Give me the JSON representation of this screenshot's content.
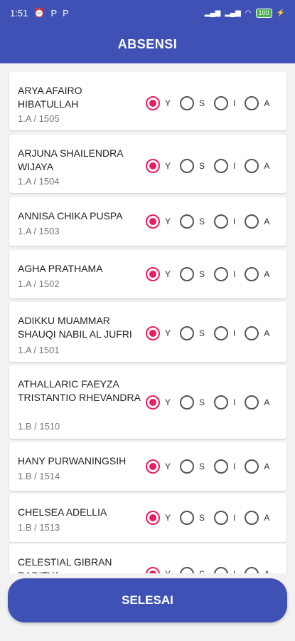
{
  "status": {
    "time": "1:51",
    "left_icons": [
      "alarm-icon",
      "parking-icon",
      "parking-icon"
    ],
    "right_icons": [
      "signal-icon",
      "signal-icon",
      "wifi-icon",
      "battery-icon",
      "charging-icon"
    ],
    "battery": "100"
  },
  "app": {
    "title": "ABSENSI"
  },
  "options": [
    "Y",
    "S",
    "I",
    "A"
  ],
  "students": [
    {
      "name": "ARYA AFAIRO HIBATULLAH",
      "info": "1.A / 1505",
      "selected": "Y"
    },
    {
      "name": "ARJUNA SHAILENDRA WIJAYA",
      "info": "1.A / 1504",
      "selected": "Y"
    },
    {
      "name": "ANNISA CHIKA PUSPA",
      "info": "1.A / 1503",
      "selected": "Y"
    },
    {
      "name": "AGHA PRATHAMA",
      "info": "1.A / 1502",
      "selected": "Y"
    },
    {
      "name": "ADIKKU MUAMMAR SHAUQI NABIL AL JUFRI",
      "info": "1.A / 1501",
      "selected": "Y"
    },
    {
      "name": "ATHALLARIC FAEYZA TRISTANTIO RHEVANDRA",
      "info": "1.B / 1510",
      "selected": "Y"
    },
    {
      "name": "HANY PURWANINGSIH",
      "info": "1.B / 1514",
      "selected": "Y"
    },
    {
      "name": "CHELSEA ADELLIA",
      "info": "1.B / 1513",
      "selected": "Y"
    },
    {
      "name": "CELESTIAL GIBRAN RADITYA",
      "info": "",
      "selected": "Y"
    }
  ],
  "footer": {
    "finish_label": "SELESAI"
  },
  "colors": {
    "primary": "#3f51b5",
    "accent": "#e91e63"
  }
}
